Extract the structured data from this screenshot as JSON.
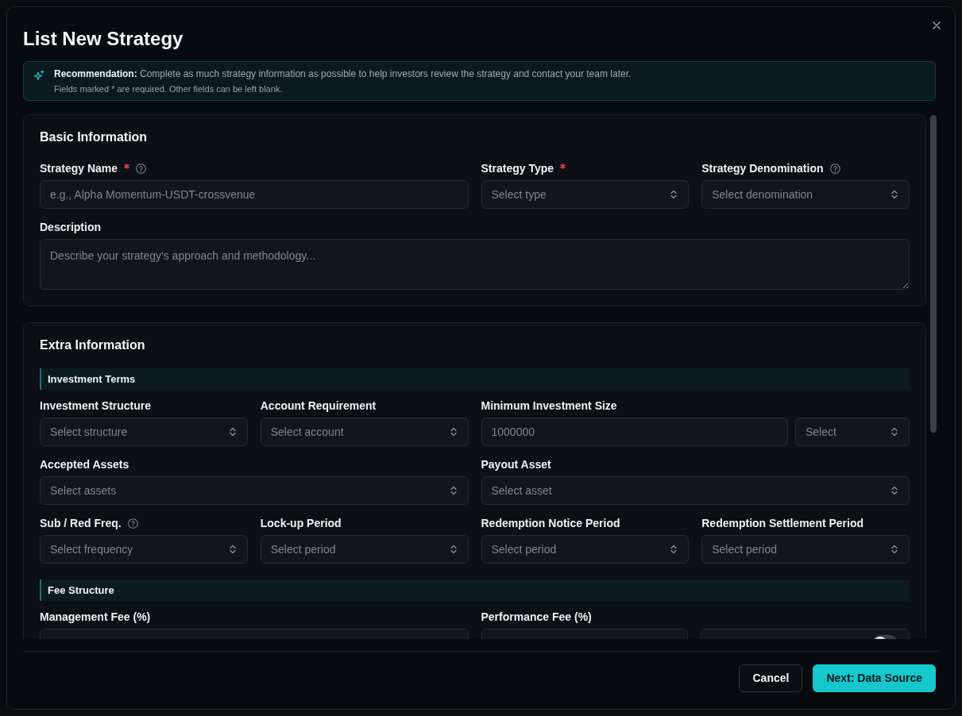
{
  "dialog": {
    "title": "List New Strategy"
  },
  "recommendation": {
    "text": "**Recommendation:** Complete as much strategy information as possible to help investors review the strategy and contact your team later.",
    "note": "Fields marked * are required. Other fields can be left blank."
  },
  "sections": [
    {
      "title": "Basic Information",
      "groups": [
        {
          "fields": [
            {
              "label": "Strategy Name",
              "required": true,
              "help": true,
              "controls": [
                {
                  "kind": "input",
                  "placeholder": "e.g., Alpha Momentum-USDT-crossvenue"
                }
              ]
            },
            {
              "label": "Strategy Type",
              "required": true,
              "help": false,
              "controls": [
                {
                  "kind": "select",
                  "placeholder": "Select type"
                }
              ]
            },
            {
              "label": "Strategy Denomination",
              "required": false,
              "help": true,
              "controls": [
                {
                  "kind": "select",
                  "placeholder": "Select denomination"
                }
              ]
            },
            {
              "label": "Description",
              "required": false,
              "help": false,
              "controls": [
                {
                  "kind": "textarea",
                  "placeholder": "Describe your strategy's approach and methodology..."
                }
              ]
            }
          ]
        }
      ]
    },
    {
      "title": "Extra Information",
      "groups": [
        {
          "heading": "Investment Terms",
          "fields": [
            {
              "label": "Investment Structure",
              "required": false,
              "help": false,
              "controls": [
                {
                  "kind": "select",
                  "placeholder": "Select structure"
                }
              ]
            },
            {
              "label": "Account Requirement",
              "required": false,
              "help": false,
              "controls": [
                {
                  "kind": "select",
                  "placeholder": "Select account"
                }
              ]
            },
            {
              "label": "Minimum Investment Size",
              "required": false,
              "help": false,
              "controls": [
                {
                  "kind": "input",
                  "placeholder": "1000000"
                },
                {
                  "kind": "unit-select",
                  "placeholder": "Select"
                }
              ]
            },
            {
              "label": "Accepted Assets",
              "required": false,
              "help": false,
              "controls": [
                {
                  "kind": "select",
                  "placeholder": "Select assets"
                }
              ]
            },
            {
              "label": "Payout Asset",
              "required": false,
              "help": false,
              "controls": [
                {
                  "kind": "select",
                  "placeholder": "Select asset"
                }
              ]
            },
            {
              "label": "Sub / Red Freq.",
              "required": false,
              "help": true,
              "controls": [
                {
                  "kind": "select",
                  "placeholder": "Select frequency"
                }
              ]
            },
            {
              "label": "Lock-up Period",
              "required": false,
              "help": false,
              "controls": [
                {
                  "kind": "select",
                  "placeholder": "Select period"
                }
              ]
            },
            {
              "label": "Redemption Notice Period",
              "required": false,
              "help": false,
              "controls": [
                {
                  "kind": "select",
                  "placeholder": "Select period"
                }
              ]
            },
            {
              "label": "Redemption Settlement Period",
              "required": false,
              "help": false,
              "controls": [
                {
                  "kind": "select",
                  "placeholder": "Select period"
                }
              ]
            }
          ]
        },
        {
          "heading": "Fee Structure",
          "fields": [
            {
              "label": "Management Fee (%)",
              "required": false,
              "help": false,
              "controls": [
                {
                  "kind": "input"
                }
              ]
            },
            {
              "label": "Performance Fee (%)",
              "required": false,
              "help": false,
              "controls": [
                {
                  "kind": "input"
                },
                {
                  "kind": "switch-input",
                  "on": false
                }
              ]
            }
          ]
        }
      ]
    }
  ],
  "footer": {
    "buttons": [
      {
        "label": "Cancel",
        "kind": "secondary"
      },
      {
        "label": "Next: Data Source",
        "kind": "primary"
      }
    ]
  }
}
